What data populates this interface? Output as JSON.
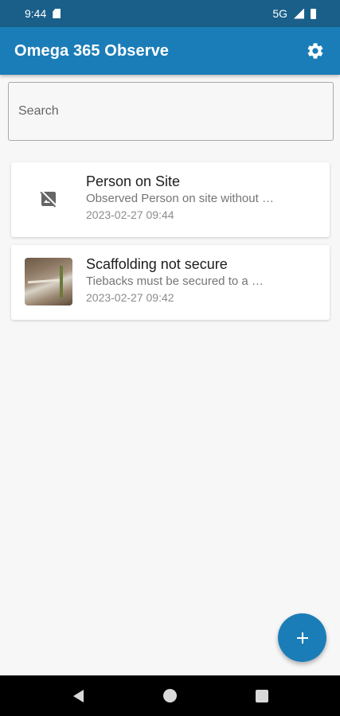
{
  "status_bar": {
    "time": "9:44",
    "network": "5G"
  },
  "app_bar": {
    "title": "Omega 365 Observe"
  },
  "search": {
    "placeholder": "Search"
  },
  "observations": [
    {
      "title": "Person on Site",
      "description": "Observed Person on site without …",
      "date": "2023-02-27 09:44",
      "thumbnail": "no-image-icon"
    },
    {
      "title": "Scaffolding not secure",
      "description": "Tiebacks must be secured to a …",
      "date": "2023-02-27 09:42",
      "thumbnail": "photo"
    }
  ],
  "fab": {
    "icon": "plus-icon"
  },
  "colors": {
    "status_bar": "#1a5f89",
    "app_bar": "#1b7db8",
    "accent": "#1b7db8",
    "background": "#f7f7f7"
  }
}
